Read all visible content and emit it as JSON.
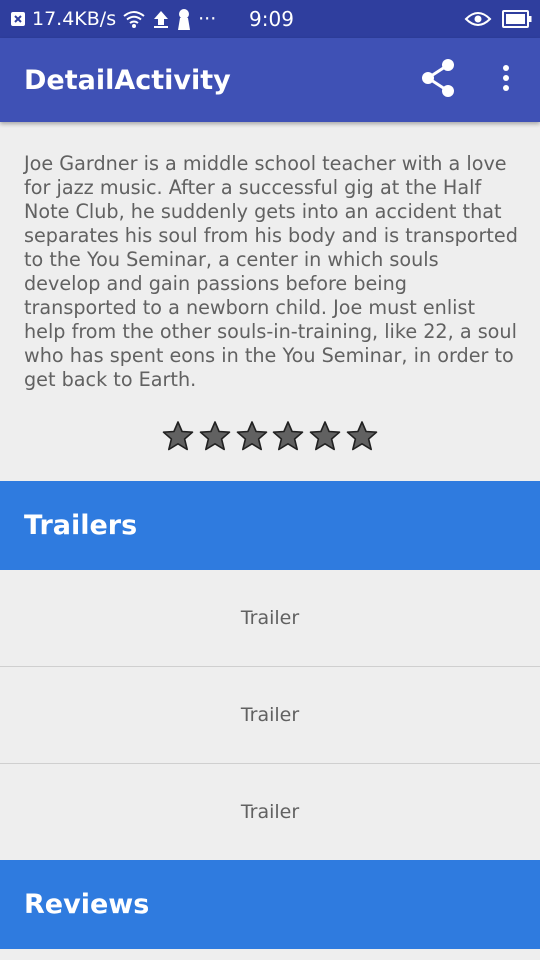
{
  "status_bar": {
    "net_speed": "17.4KB/s",
    "ellipsis": "···",
    "time": "9:09",
    "icons": [
      "close-box-icon",
      "wifi-icon",
      "upload-icon",
      "keyhole-icon",
      "eye-icon",
      "battery-icon"
    ]
  },
  "app_bar": {
    "title": "DetailActivity",
    "icons": [
      "share-icon",
      "more-vert-icon"
    ]
  },
  "movie": {
    "overview": "Joe Gardner is a middle school teacher with a love for jazz music. After a successful gig at the Half Note Club, he suddenly gets into an accident that separates his soul from his body and is transported to the You Seminar, a center in which souls develop and gain passions before being transported to a newborn child. Joe must enlist help from the other souls-in-training, like 22, a soul who has spent eons in the You Seminar, in order to get back to Earth.",
    "rating": {
      "stars_total": 6,
      "stars_filled": 6
    }
  },
  "trailers": {
    "header": "Trailers",
    "items": [
      {
        "label": "Trailer"
      },
      {
        "label": "Trailer"
      },
      {
        "label": "Trailer"
      }
    ]
  },
  "reviews": {
    "header": "Reviews"
  },
  "colors": {
    "status_bar": "#2f3e9e",
    "app_bar": "#3f51b5",
    "section_header": "#2f7bdf",
    "background": "#eeeeee",
    "star_fill": "#616161"
  }
}
